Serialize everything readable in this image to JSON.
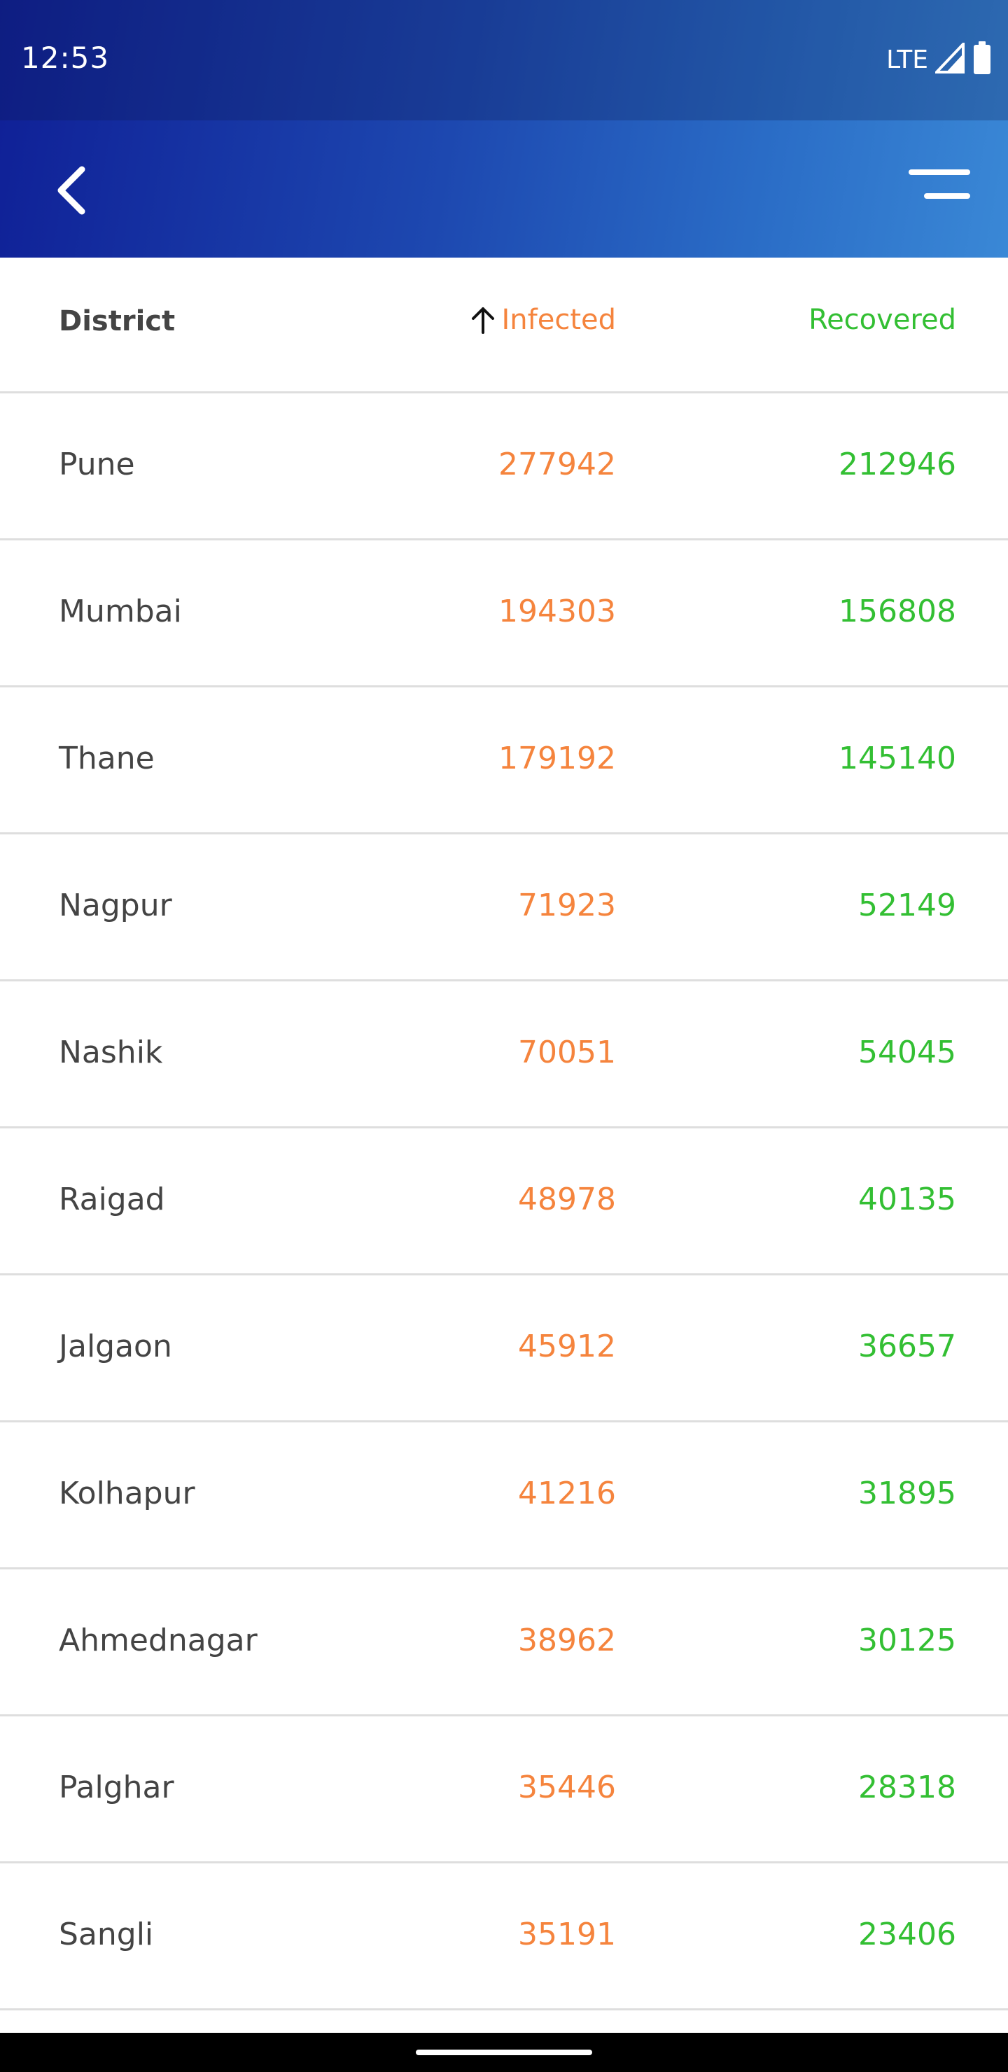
{
  "status_bar": {
    "time": "12:53",
    "network": "LTE",
    "icons": [
      "signal-icon",
      "battery-icon"
    ]
  },
  "app_bar": {
    "back_icon": "chevron-left-icon",
    "menu_icon": "menu-icon"
  },
  "table": {
    "headers": {
      "district": "District",
      "infected": "Infected",
      "recovered": "Recovered",
      "sort_icon": "arrow-up-icon"
    },
    "rows": [
      {
        "district": "Pune",
        "infected": "277942",
        "recovered": "212946"
      },
      {
        "district": "Mumbai",
        "infected": "194303",
        "recovered": "156808"
      },
      {
        "district": "Thane",
        "infected": "179192",
        "recovered": "145140"
      },
      {
        "district": "Nagpur",
        "infected": "71923",
        "recovered": "52149"
      },
      {
        "district": "Nashik",
        "infected": "70051",
        "recovered": "54045"
      },
      {
        "district": "Raigad",
        "infected": "48978",
        "recovered": "40135"
      },
      {
        "district": "Jalgaon",
        "infected": "45912",
        "recovered": "36657"
      },
      {
        "district": "Kolhapur",
        "infected": "41216",
        "recovered": "31895"
      },
      {
        "district": "Ahmednagar",
        "infected": "38962",
        "recovered": "30125"
      },
      {
        "district": "Palghar",
        "infected": "35446",
        "recovered": "28318"
      },
      {
        "district": "Sangli",
        "infected": "35191",
        "recovered": "23406"
      }
    ]
  },
  "colors": {
    "infected": "#f5843d",
    "recovered": "#33bf33",
    "header_gradient_start": "#0f1f96",
    "header_gradient_end": "#3a88d6"
  }
}
